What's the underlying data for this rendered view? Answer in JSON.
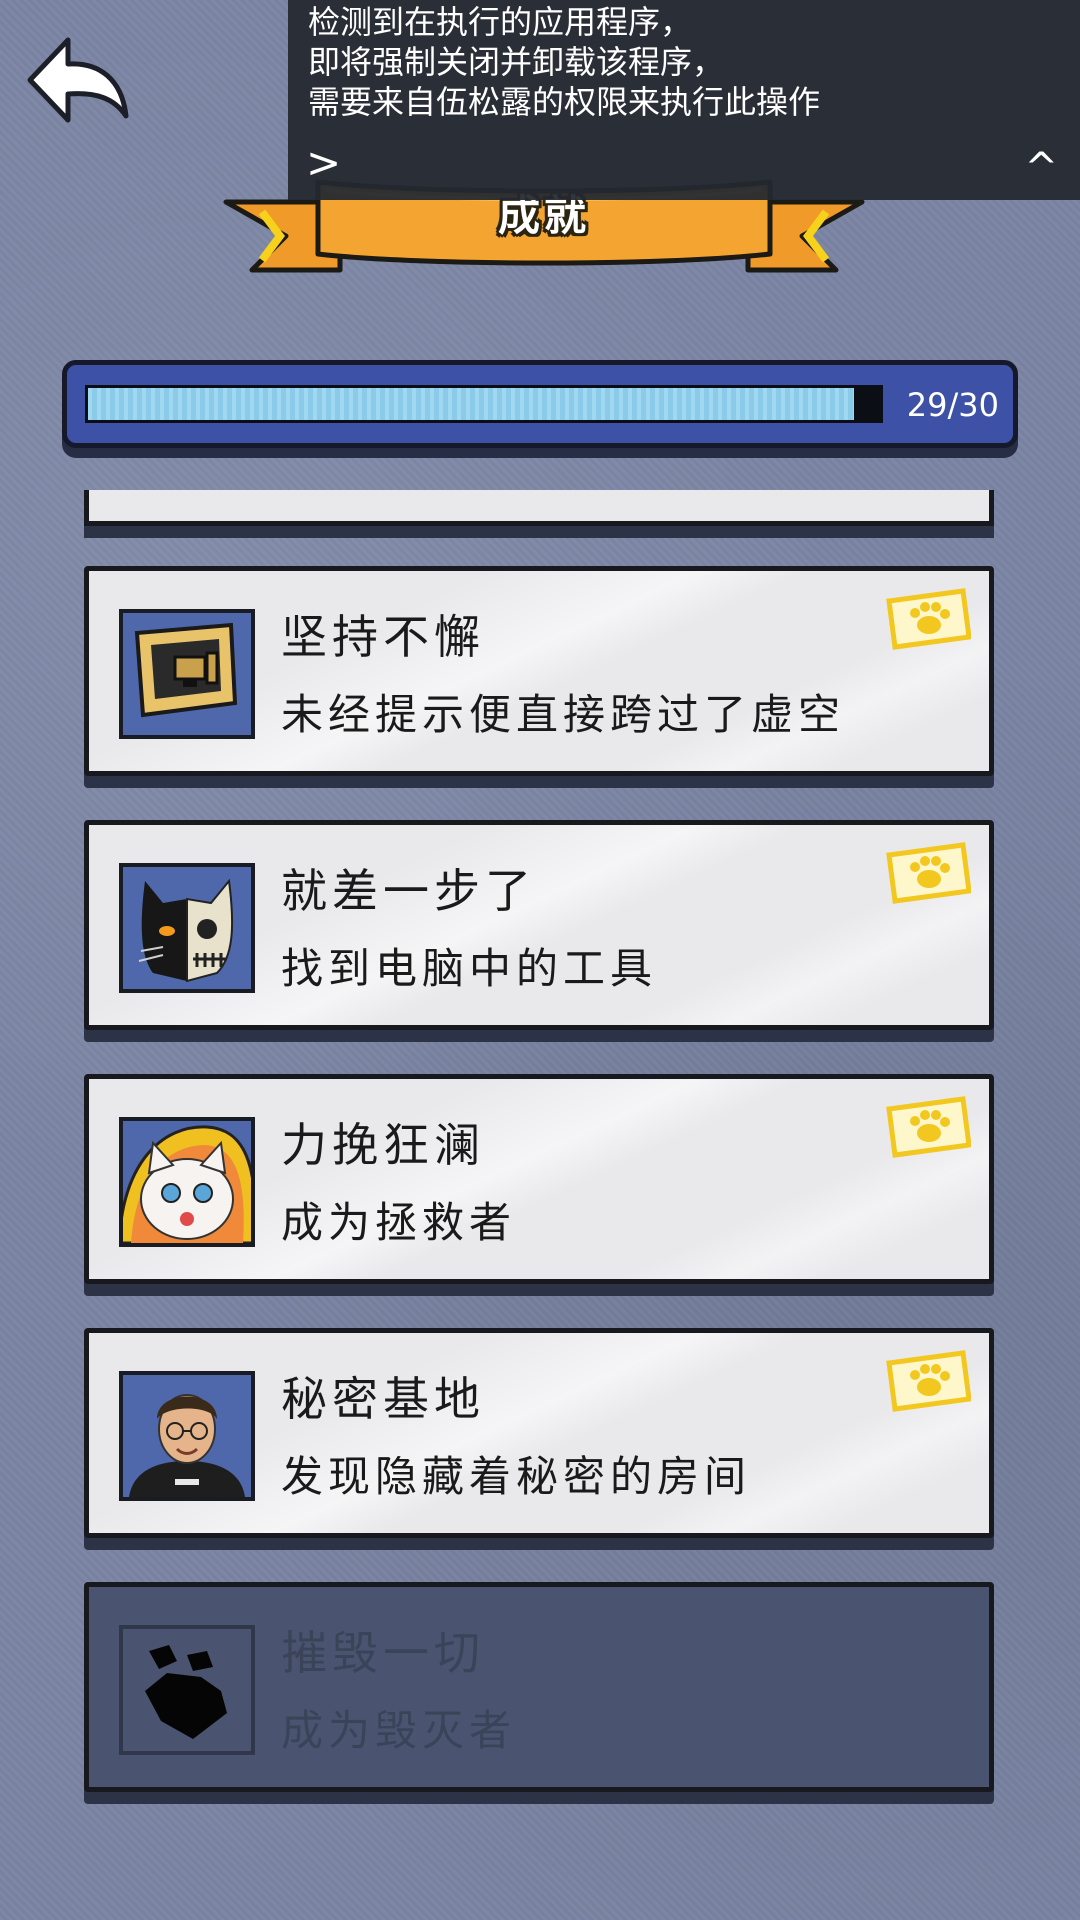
{
  "notice": {
    "lines": [
      "检测到在执行的应用程序，",
      "即将强制关闭并卸载该程序，",
      "需要来自伍松露的权限来执行此操作"
    ],
    "expand_label": ">",
    "collapse_label": "^"
  },
  "header": {
    "title": "成就"
  },
  "progress": {
    "current": 29,
    "total": 30,
    "label": "29/30"
  },
  "achievements": [
    {
      "title": "坚持不懈",
      "description": "未经提示便直接跨过了虚空",
      "icon": "monitor-icon",
      "unlocked": true
    },
    {
      "title": "就差一步了",
      "description": "找到电脑中的工具",
      "icon": "skull-cat-icon",
      "unlocked": true
    },
    {
      "title": "力挽狂澜",
      "description": "成为拯救者",
      "icon": "white-cat-icon",
      "unlocked": true
    },
    {
      "title": "秘密基地",
      "description": "发现隐藏着秘密的房间",
      "icon": "man-portrait-icon",
      "unlocked": true
    },
    {
      "title": "摧毁一切",
      "description": "成为毁灭者",
      "icon": "rock-silhouette-icon",
      "unlocked": false
    }
  ],
  "colors": {
    "background": "#7b85a4",
    "progress_fill": "#8fd0ef",
    "progress_frame": "#3d52a6",
    "card": "#e9e9ec",
    "card_locked": "#4a5470",
    "banner": "#f09a2a",
    "stamp": "#f2c820"
  }
}
